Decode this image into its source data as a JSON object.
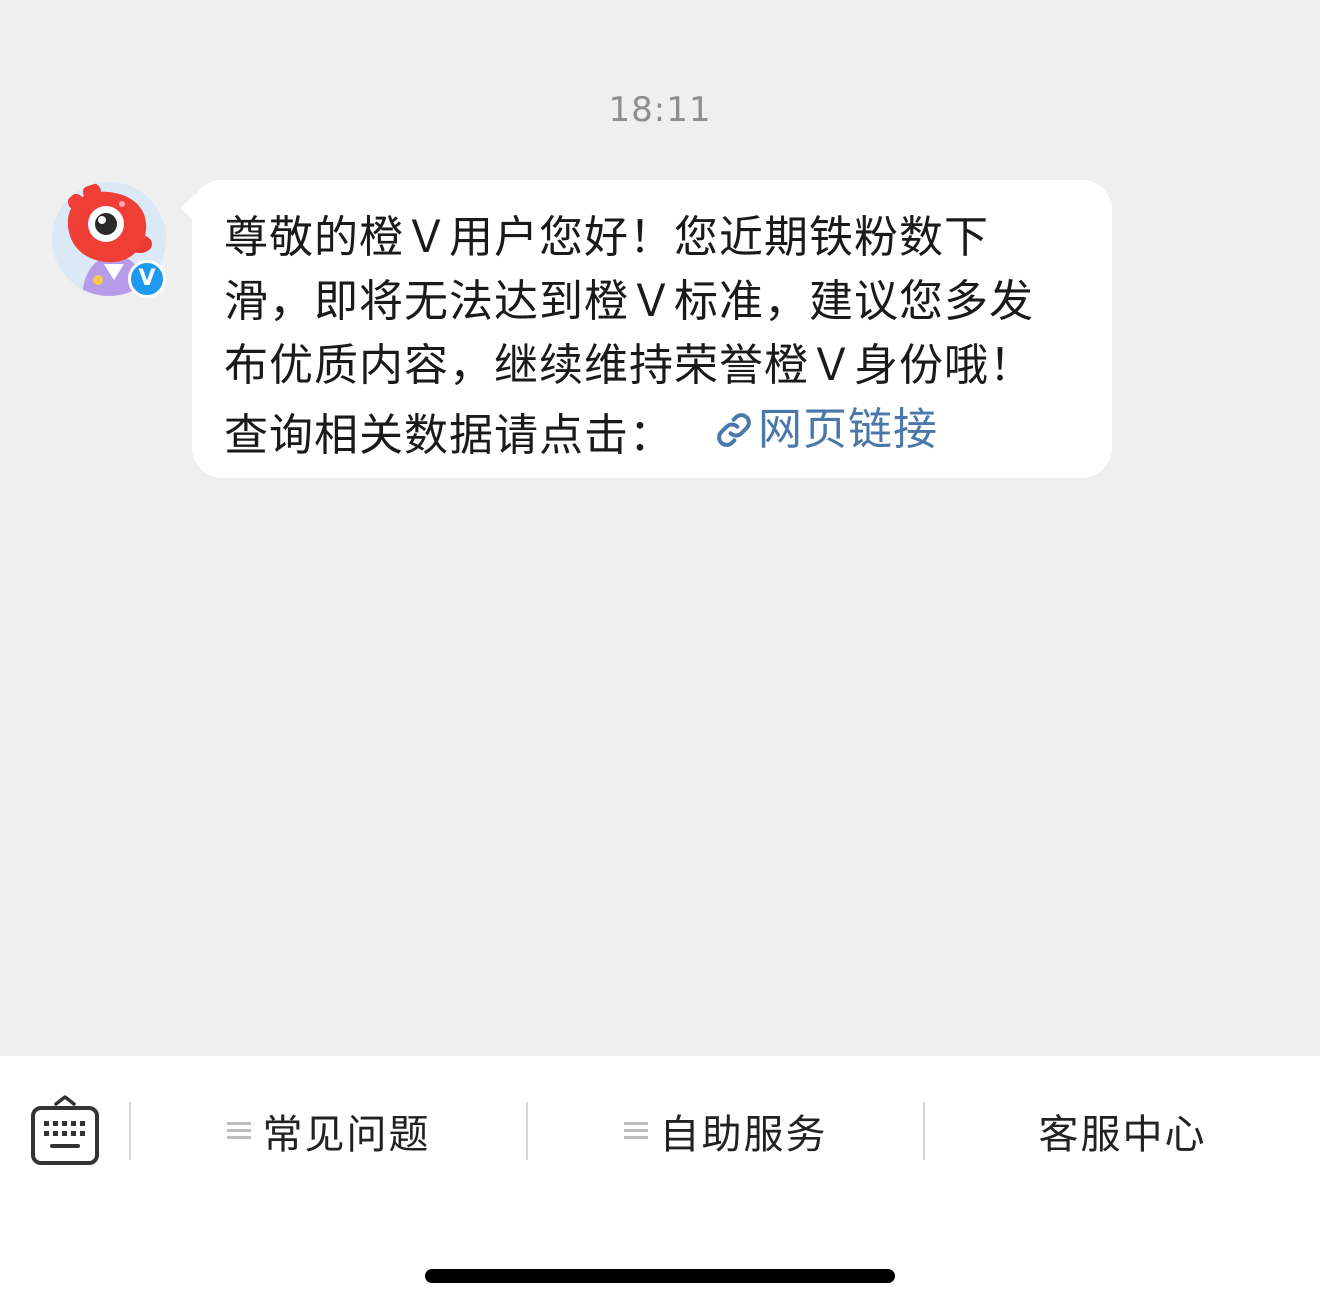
{
  "chat": {
    "timestamp": "18:11",
    "message": {
      "lines": [
        "尊敬的橙Ｖ用户您好！您近期铁粉数下",
        "滑，即将无法达到橙Ｖ标准，建议您多发",
        "布优质内容，继续维持荣誉橙Ｖ身份哦！",
        "查询相关数据请点击："
      ],
      "link_label": "网页链接"
    },
    "avatar": {
      "icon": "weibo-mascot-avatar",
      "badge": "V"
    }
  },
  "bottom_bar": {
    "keyboard_icon": "keyboard-icon",
    "menu": [
      {
        "label": "常见问题",
        "has_menu_icon": true
      },
      {
        "label": "自助服务",
        "has_menu_icon": true
      },
      {
        "label": "客服中心",
        "has_menu_icon": false
      }
    ]
  },
  "colors": {
    "background": "#efefef",
    "bubble": "#ffffff",
    "link": "#4a78ab",
    "badge": "#1e9af0"
  }
}
